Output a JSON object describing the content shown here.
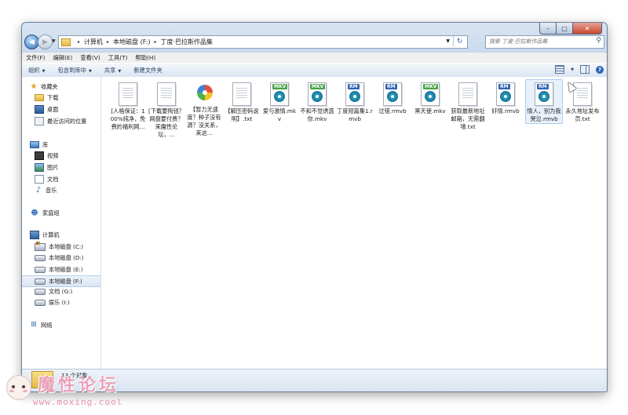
{
  "window": {
    "caption": {
      "minimize": "–",
      "maximize": "□",
      "close": "✕"
    }
  },
  "address_bar": {
    "recent_symbol": "▼",
    "breadcrumbs": [
      "计算机",
      "本地磁盘 (F:)",
      "丁度·巴拉斯作品集"
    ],
    "separator": "▸",
    "dropdown_symbol": "▼",
    "refresh_symbol": "↻"
  },
  "search": {
    "placeholder": "搜索 丁度·巴拉斯作品集",
    "icon": "search-icon"
  },
  "menubar": [
    "文件(F)",
    "编辑(E)",
    "查看(V)",
    "工具(T)",
    "帮助(H)"
  ],
  "toolbar": {
    "organize": "组织",
    "include_library": "包含到库中",
    "share": "共享",
    "new_folder": "新建文件夹",
    "dropdown_symbol": "▼",
    "help_symbol": "?"
  },
  "nav": {
    "favorites": "收藏夹",
    "downloads": "下载",
    "desktop": "桌面",
    "recent": "最近访问的位置",
    "libraries": "库",
    "videos": "视频",
    "pictures": "图片",
    "documents": "文档",
    "music": "音乐",
    "homegroup": "家庭组",
    "computer": "计算机",
    "drives": [
      "本地磁盘 (C:)",
      "本地磁盘 (D:)",
      "本地磁盘 (E:)",
      "本地磁盘 (F:)",
      "文档 (G:)",
      "娱乐 (I:)"
    ],
    "network": "网络"
  },
  "files": [
    {
      "name": "[人格保证：100%纯净，免费的福利网...",
      "icon": "text-document-icon"
    },
    {
      "name": "[下载要掏钱？网盘要付费？来魔性论坛，...",
      "icon": "text-document-icon"
    },
    {
      "name": "【暂力无速度？种子没有源？没关系，来这...",
      "icon": "application-icon"
    },
    {
      "name": "【解压密码说明】.txt",
      "icon": "text-document-icon"
    },
    {
      "name": "爱与激情.mkv",
      "icon": "mkv-video-icon",
      "tag": "MKV",
      "tag_color": "#4aa34a"
    },
    {
      "name": "不和不觉诱惑你.mkv",
      "icon": "mkv-video-icon",
      "tag": "MKV",
      "tag_color": "#4aa34a"
    },
    {
      "name": "丁度短篇集1.rmvb",
      "icon": "rmvb-video-icon",
      "tag": "RM",
      "tag_color": "#2f66b3"
    },
    {
      "name": "过错.rmvb",
      "icon": "rmvb-video-icon",
      "tag": "RM",
      "tag_color": "#2f66b3"
    },
    {
      "name": "黑天使.mkv",
      "icon": "mkv-video-icon",
      "tag": "MKV",
      "tag_color": "#4aa34a"
    },
    {
      "name": "获取最新地址邮箱，无需翻墙.txt",
      "icon": "text-document-icon"
    },
    {
      "name": "奸情.rmvb",
      "icon": "rmvb-video-icon",
      "tag": "RM",
      "tag_color": "#2f66b3"
    },
    {
      "name": "情人，别为我哭泣.rmvb",
      "icon": "rmvb-video-icon",
      "tag": "RM",
      "tag_color": "#2f66b3"
    },
    {
      "name": "永久地址发布页.txt",
      "icon": "text-document-icon"
    }
  ],
  "status": {
    "count": "13 个对象"
  },
  "watermark": {
    "title": "魔性论坛",
    "url": "www.moxing.cool"
  },
  "colors": {
    "selection": "#e8f1fb",
    "accent": "#2f66b3"
  }
}
